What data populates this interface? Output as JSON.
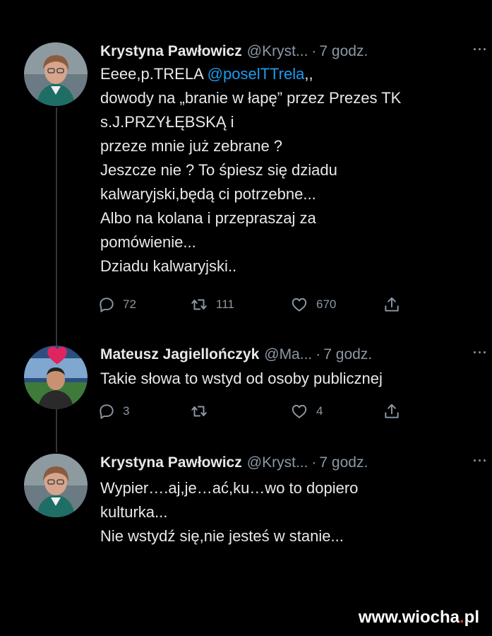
{
  "tweets": [
    {
      "name": "Krystyna Pawłowicz",
      "handle": "@Kryst...",
      "separator": "·",
      "time": "7 godz.",
      "more": "···",
      "lines": [
        {
          "before": "Eeee,p.TRELA ",
          "mention": "@poselTTrela",
          "after": ",,"
        },
        {
          "text": "dowody na „branie w łapę” przez Prezes TK"
        },
        {
          "text": "s.J.PRZYŁĘBSKĄ i"
        },
        {
          "text": "przeze mnie już zebrane ?"
        },
        {
          "text": "Jeszcze nie ? To śpiesz się dziadu"
        },
        {
          "text": "kalwaryjski,będą ci potrzebne..."
        },
        {
          "text": "Albo na kolana i przepraszaj za"
        },
        {
          "text": "pomówienie..."
        },
        {
          "text": "Dziadu kalwaryjski.."
        }
      ],
      "stats": {
        "replies": "72",
        "retweets": "111",
        "likes": "670"
      }
    },
    {
      "name": "Mateusz Jagiellończyk",
      "handle": "@Ma...",
      "separator": "·",
      "time": "7 godz.",
      "more": "···",
      "lines": [
        {
          "text": "Takie słowa to wstyd od osoby publicznej"
        }
      ],
      "stats": {
        "replies": "3",
        "retweets": "",
        "likes": "4"
      }
    },
    {
      "name": "Krystyna Pawłowicz",
      "handle": "@Kryst...",
      "separator": "·",
      "time": "7 godz.",
      "more": "···",
      "lines": [
        {
          "text": "Wypier….aj,je…ać,ku…wo to dopiero"
        },
        {
          "text": "kulturka..."
        },
        {
          "text": "Nie wstydź się,nie jesteś w stanie..."
        }
      ]
    }
  ],
  "watermark": {
    "prefix": "www.wiocha",
    "dot": ".",
    "suffix": "pl"
  },
  "colors": {
    "background": "#000000",
    "text": "#e7e9ea",
    "secondary": "#8b98a5",
    "mention": "#1d9bf0",
    "heart": "#e0245e"
  },
  "icons": [
    "reply-icon",
    "retweet-icon",
    "like-icon",
    "share-icon",
    "more-icon"
  ]
}
